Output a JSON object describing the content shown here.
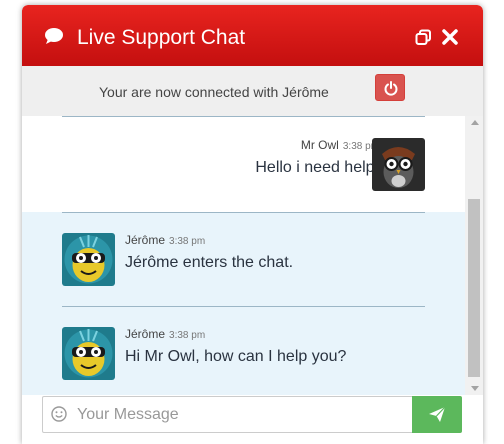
{
  "header": {
    "title": "Live Support Chat"
  },
  "status": {
    "text": "Your are now connected with Jérôme"
  },
  "messages": [
    {
      "sender": "Mr Owl",
      "time": "3:38 pm",
      "text": "Hello i need help!"
    },
    {
      "sender": "Jérôme",
      "time": "3:38 pm",
      "text": "Jérôme enters the chat."
    },
    {
      "sender": "Jérôme",
      "time": "3:38 pm",
      "text": "Hi Mr Owl, how can I help you?"
    }
  ],
  "input": {
    "placeholder": "Your Message"
  },
  "colors": {
    "header": "#d71a17",
    "send": "#5cb85c",
    "power": "#d9534f",
    "agent_bg": "#e8f4fb"
  },
  "icons": [
    "chat-bubble-icon",
    "restore-window-icon",
    "close-icon",
    "volume-icon",
    "power-icon",
    "smile-icon",
    "send-paper-plane-icon"
  ]
}
